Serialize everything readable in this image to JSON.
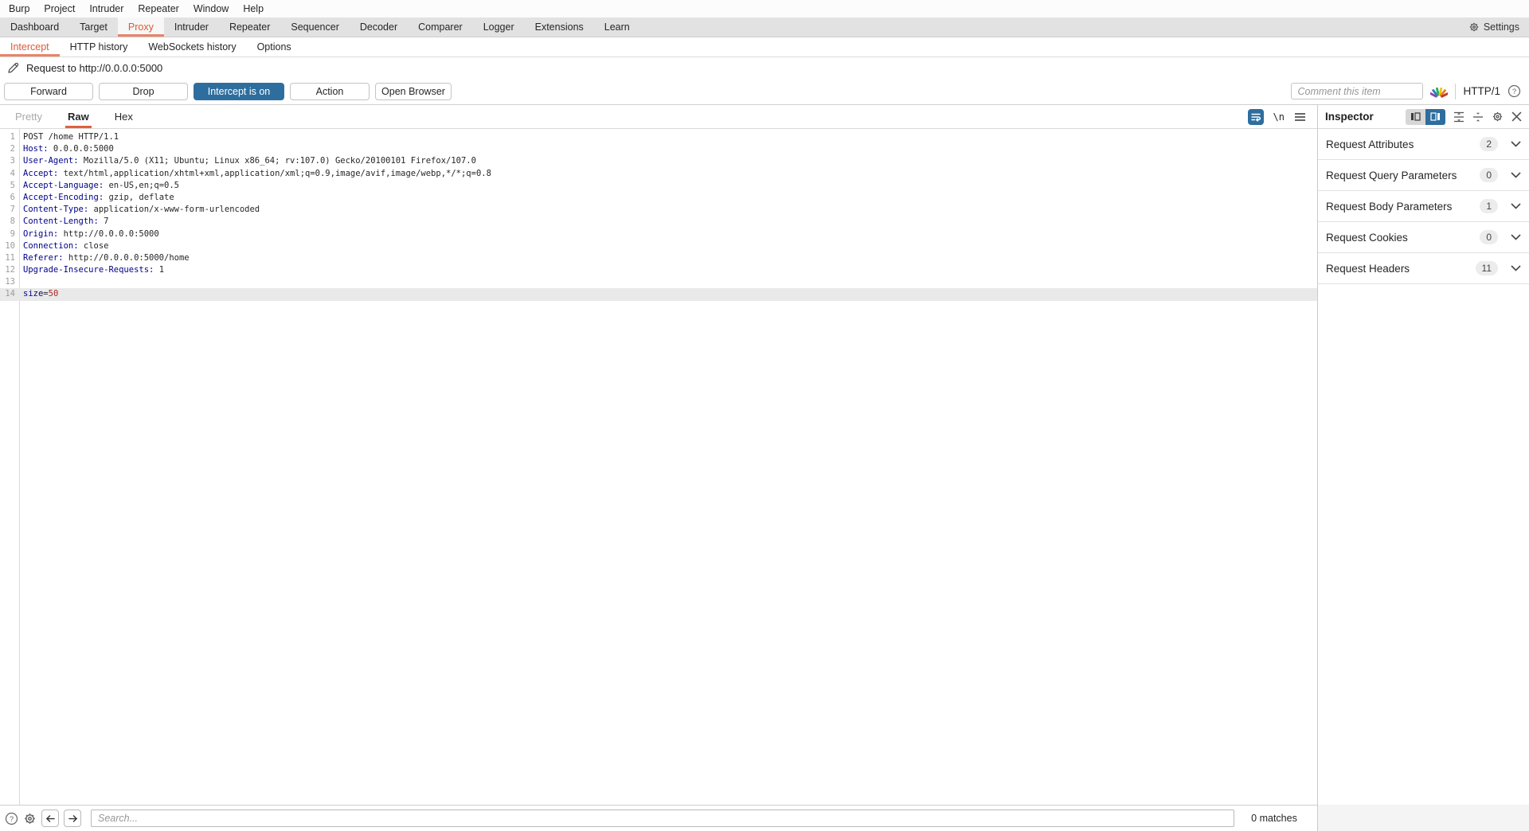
{
  "menu": {
    "items": [
      "Burp",
      "Project",
      "Intruder",
      "Repeater",
      "Window",
      "Help"
    ]
  },
  "tabs": {
    "items": [
      "Dashboard",
      "Target",
      "Proxy",
      "Intruder",
      "Repeater",
      "Sequencer",
      "Decoder",
      "Comparer",
      "Logger",
      "Extensions",
      "Learn"
    ],
    "selected": "Proxy",
    "settings": "Settings"
  },
  "subtabs": {
    "items": [
      "Intercept",
      "HTTP history",
      "WebSockets history",
      "Options"
    ],
    "selected": "Intercept"
  },
  "request_bar": {
    "title": "Request to http://0.0.0.0:5000"
  },
  "actions": {
    "forward": "Forward",
    "drop": "Drop",
    "intercept": "Intercept is on",
    "action": "Action",
    "open_browser": "Open Browser",
    "comment_placeholder": "Comment this item",
    "protocol": "HTTP/1"
  },
  "editor": {
    "tabs": [
      "Pretty",
      "Raw",
      "Hex"
    ],
    "selected": "Raw",
    "disabled_tab": "Pretty",
    "newline_label": "\\n",
    "lines": [
      {
        "n": "1",
        "seg": [
          [
            "p",
            "POST /home HTTP/1.1"
          ]
        ]
      },
      {
        "n": "2",
        "seg": [
          [
            "h",
            "Host:"
          ],
          [
            "p",
            " 0.0.0.0:5000"
          ]
        ]
      },
      {
        "n": "3",
        "seg": [
          [
            "h",
            "User-Agent:"
          ],
          [
            "p",
            " Mozilla/5.0 (X11; Ubuntu; Linux x86_64; rv:107.0) Gecko/20100101 Firefox/107.0"
          ]
        ]
      },
      {
        "n": "4",
        "seg": [
          [
            "h",
            "Accept:"
          ],
          [
            "p",
            " text/html,application/xhtml+xml,application/xml;q=0.9,image/avif,image/webp,*/*;q=0.8"
          ]
        ]
      },
      {
        "n": "5",
        "seg": [
          [
            "h",
            "Accept-Language:"
          ],
          [
            "p",
            " en-US,en;q=0.5"
          ]
        ]
      },
      {
        "n": "6",
        "seg": [
          [
            "h",
            "Accept-Encoding:"
          ],
          [
            "p",
            " gzip, deflate"
          ]
        ]
      },
      {
        "n": "7",
        "seg": [
          [
            "h",
            "Content-Type:"
          ],
          [
            "p",
            " application/x-www-form-urlencoded"
          ]
        ]
      },
      {
        "n": "8",
        "seg": [
          [
            "h",
            "Content-Length:"
          ],
          [
            "p",
            " 7"
          ]
        ]
      },
      {
        "n": "9",
        "seg": [
          [
            "h",
            "Origin:"
          ],
          [
            "p",
            " http://0.0.0.0:5000"
          ]
        ]
      },
      {
        "n": "10",
        "seg": [
          [
            "h",
            "Connection:"
          ],
          [
            "p",
            " close"
          ]
        ]
      },
      {
        "n": "11",
        "seg": [
          [
            "h",
            "Referer:"
          ],
          [
            "p",
            " http://0.0.0.0:5000/home"
          ]
        ]
      },
      {
        "n": "12",
        "seg": [
          [
            "h",
            "Upgrade-Insecure-Requests:"
          ],
          [
            "p",
            " 1"
          ]
        ]
      },
      {
        "n": "13",
        "seg": []
      },
      {
        "n": "14",
        "seg": [
          [
            "h",
            "size"
          ],
          [
            "p",
            "="
          ],
          [
            "v",
            "50"
          ]
        ],
        "highlight": true
      }
    ]
  },
  "inspector": {
    "title": "Inspector",
    "sections": [
      {
        "label": "Request Attributes",
        "count": "2"
      },
      {
        "label": "Request Query Parameters",
        "count": "0"
      },
      {
        "label": "Request Body Parameters",
        "count": "1"
      },
      {
        "label": "Request Cookies",
        "count": "0"
      },
      {
        "label": "Request Headers",
        "count": "11"
      }
    ]
  },
  "search": {
    "placeholder": "Search...",
    "matches": "0 matches"
  },
  "colors": {
    "accent_orange": "#d95b36",
    "accent_orange_underline": "#e9846a",
    "accent_blue": "#2e6e9e",
    "header_token": "#00008b",
    "value_token": "#b22222"
  }
}
